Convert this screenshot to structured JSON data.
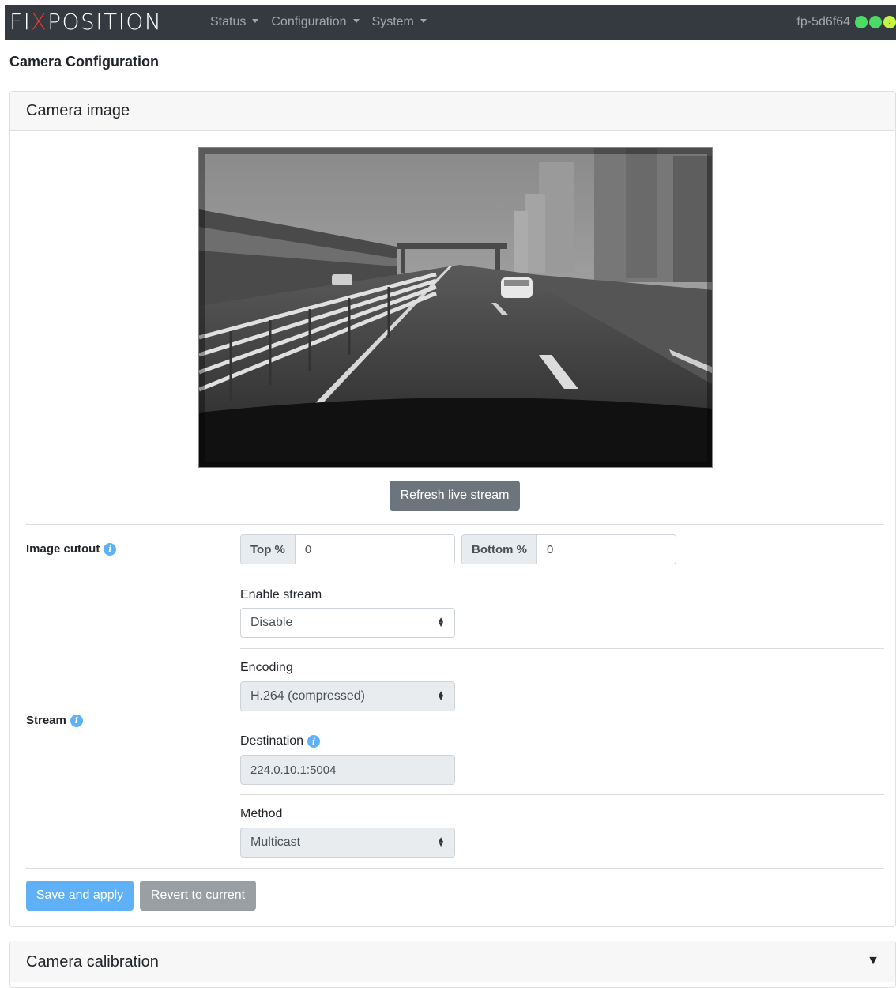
{
  "navbar": {
    "brand_part1": "FI",
    "brand_x": "X",
    "brand_part2": "POSITION",
    "menu": [
      "Status",
      "Configuration",
      "System"
    ],
    "hostname": "fp-5d6f64",
    "status_colors": [
      "#4cd964",
      "#4cd964",
      "#c5f542"
    ]
  },
  "page": {
    "title": "Camera Configuration"
  },
  "camera_image_card": {
    "header": "Camera image",
    "refresh_label": "Refresh live stream",
    "cutout": {
      "label": "Image cutout",
      "top_label": "Top %",
      "top_value": "0",
      "bottom_label": "Bottom %",
      "bottom_value": "0"
    },
    "stream": {
      "label": "Stream",
      "enable_label": "Enable stream",
      "enable_value": "Disable",
      "encoding_label": "Encoding",
      "encoding_value": "H.264 (compressed)",
      "destination_label": "Destination",
      "destination_value": "224.0.10.1:5004",
      "method_label": "Method",
      "method_value": "Multicast"
    },
    "save_label": "Save and apply",
    "revert_label": "Revert to current"
  },
  "calibration_card": {
    "header": "Camera calibration",
    "toggle": "▼"
  },
  "colors": {
    "navbar": "#343a40",
    "primary": "#5eb1f7",
    "secondary": "#6c757d"
  }
}
